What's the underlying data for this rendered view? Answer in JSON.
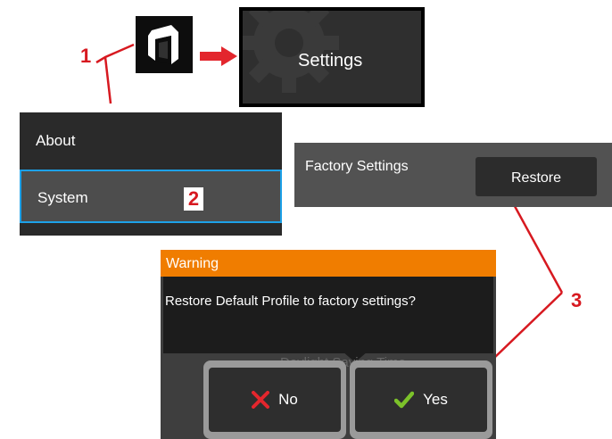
{
  "callouts": {
    "c1": "1",
    "c2": "2",
    "c3": "3"
  },
  "settings_tile": {
    "label": "Settings"
  },
  "menu": {
    "items": [
      {
        "label": "About"
      },
      {
        "label": "System"
      }
    ]
  },
  "factory": {
    "label": "Factory Settings",
    "restore_label": "Restore"
  },
  "dialog": {
    "title": "Warning",
    "message": "Restore Default Profile to factory settings?",
    "background_text": "Daylight Saving Time",
    "no_label": "No",
    "yes_label": "Yes"
  },
  "colors": {
    "callout": "#d71920",
    "warning_header": "#f07d00",
    "selection_border": "#1da1e8",
    "no_icon": "#e3262d",
    "yes_icon": "#7cc22a"
  },
  "icons": [
    "app-launcher-icon",
    "arrow-right-icon",
    "gear-icon",
    "x-icon",
    "checkmark-icon"
  ]
}
